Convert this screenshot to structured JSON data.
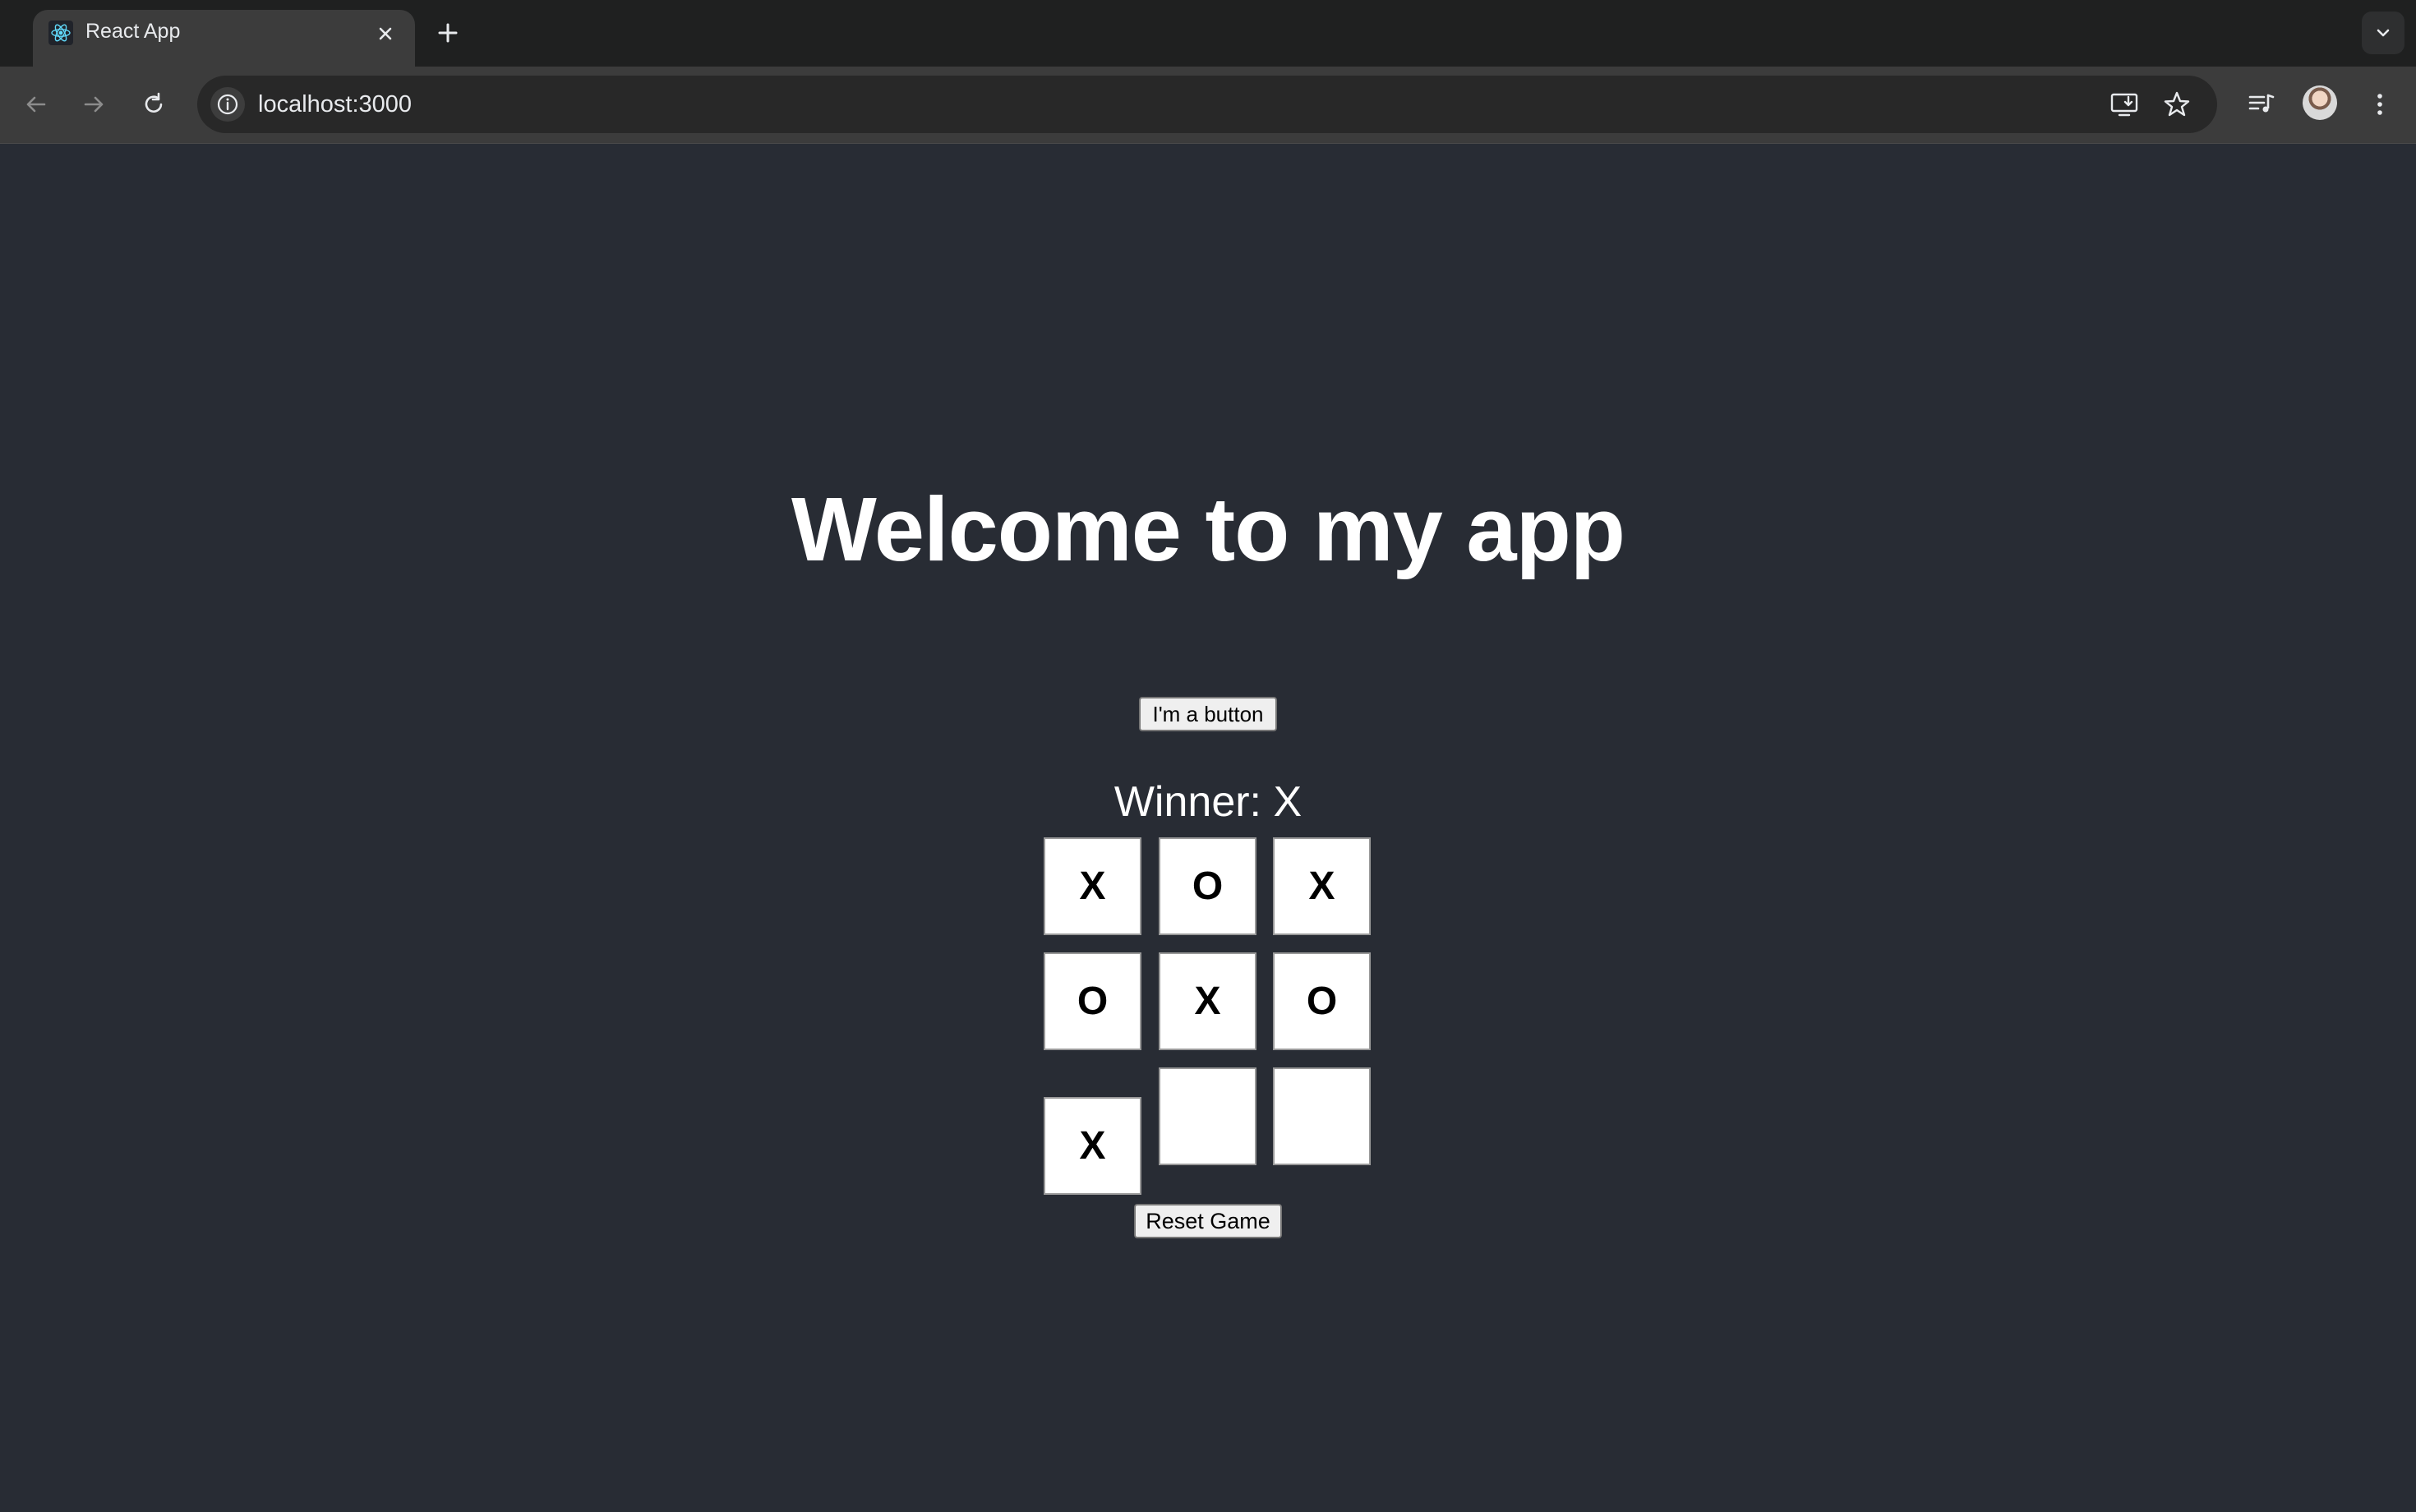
{
  "browser": {
    "tab_title": "React App",
    "url": "localhost:3000",
    "icons": {
      "favicon": "react-logo-icon",
      "close": "close-icon",
      "new_tab": "plus-icon",
      "tab_search": "chevron-down-icon",
      "back": "arrow-left-icon",
      "forward": "arrow-right-icon",
      "reload": "reload-icon",
      "site_info": "info-icon",
      "install": "install-app-icon",
      "bookmark": "star-icon",
      "media": "media-controls-icon",
      "menu": "kebab-menu-icon"
    }
  },
  "page": {
    "heading": "Welcome to my app",
    "primary_button": "I'm a button",
    "status": "Winner: X",
    "board": {
      "squares": [
        "X",
        "O",
        "X",
        "O",
        "X",
        "O",
        "X",
        "",
        ""
      ]
    },
    "reset_button": "Reset Game"
  },
  "colors": {
    "page_background": "#282c34",
    "chrome_dark": "#1f2020",
    "chrome_toolbar": "#3c3c3c",
    "text_light": "#ffffff",
    "react_blue": "#61dafb"
  }
}
